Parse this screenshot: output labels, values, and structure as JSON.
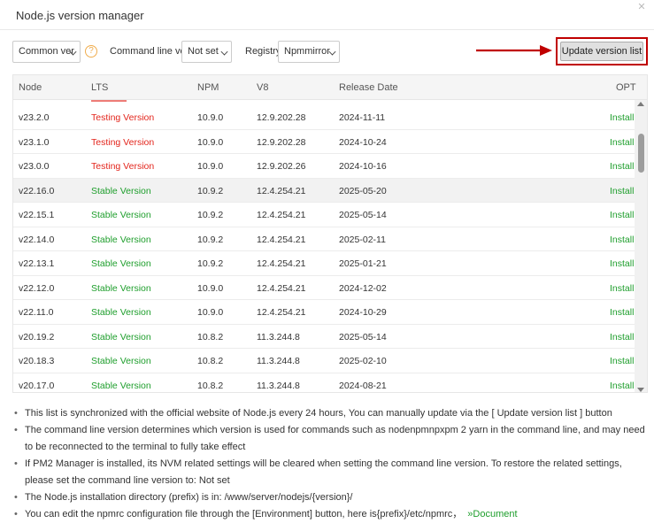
{
  "window": {
    "title": "Node.js version manager"
  },
  "toolbar": {
    "version_filter": "Common ver",
    "help_icon": "?",
    "cmd_label": "Command line ver",
    "cmd_value": "Not set",
    "registry_label": "Registry",
    "registry_value": "Npmmirror",
    "update_label": "Update version list"
  },
  "table": {
    "headers": [
      "Node",
      "LTS",
      "NPM",
      "V8",
      "Release Date",
      "OPT"
    ],
    "rows": [
      {
        "node": "v23.2.0",
        "lts": "Testing Version",
        "npm": "10.9.0",
        "v8": "12.9.202.28",
        "date": "2024-11-11",
        "opt": "Install",
        "kind": "testing"
      },
      {
        "node": "v23.1.0",
        "lts": "Testing Version",
        "npm": "10.9.0",
        "v8": "12.9.202.28",
        "date": "2024-10-24",
        "opt": "Install",
        "kind": "testing"
      },
      {
        "node": "v23.0.0",
        "lts": "Testing Version",
        "npm": "10.9.0",
        "v8": "12.9.202.26",
        "date": "2024-10-16",
        "opt": "Install",
        "kind": "testing"
      },
      {
        "node": "v22.16.0",
        "lts": "Stable Version",
        "npm": "10.9.2",
        "v8": "12.4.254.21",
        "date": "2025-05-20",
        "opt": "Install",
        "kind": "stable"
      },
      {
        "node": "v22.15.1",
        "lts": "Stable Version",
        "npm": "10.9.2",
        "v8": "12.4.254.21",
        "date": "2025-05-14",
        "opt": "Install",
        "kind": "stable"
      },
      {
        "node": "v22.14.0",
        "lts": "Stable Version",
        "npm": "10.9.2",
        "v8": "12.4.254.21",
        "date": "2025-02-11",
        "opt": "Install",
        "kind": "stable"
      },
      {
        "node": "v22.13.1",
        "lts": "Stable Version",
        "npm": "10.9.2",
        "v8": "12.4.254.21",
        "date": "2025-01-21",
        "opt": "Install",
        "kind": "stable"
      },
      {
        "node": "v22.12.0",
        "lts": "Stable Version",
        "npm": "10.9.0",
        "v8": "12.4.254.21",
        "date": "2024-12-02",
        "opt": "Install",
        "kind": "stable"
      },
      {
        "node": "v22.11.0",
        "lts": "Stable Version",
        "npm": "10.9.0",
        "v8": "12.4.254.21",
        "date": "2024-10-29",
        "opt": "Install",
        "kind": "stable"
      },
      {
        "node": "v20.19.2",
        "lts": "Stable Version",
        "npm": "10.8.2",
        "v8": "11.3.244.8",
        "date": "2025-05-14",
        "opt": "Install",
        "kind": "stable"
      },
      {
        "node": "v20.18.3",
        "lts": "Stable Version",
        "npm": "10.8.2",
        "v8": "11.3.244.8",
        "date": "2025-02-10",
        "opt": "Install",
        "kind": "stable"
      },
      {
        "node": "v20.17.0",
        "lts": "Stable Version",
        "npm": "10.8.2",
        "v8": "11.3.244.8",
        "date": "2024-08-21",
        "opt": "Install",
        "kind": "stable"
      }
    ],
    "hover_row_index": 3
  },
  "notes": {
    "items": [
      "This list is synchronized with the official website of Node.js every 24 hours, You can manually update via the [ Update version list ] button",
      "The command line version determines which version is used for commands such as nodenpmnpxpm 2 yarn in the command line, and may need to be reconnected to the terminal to fully take effect",
      "If PM2 Manager is installed, its NVM related settings will be cleared when setting the command line version. To restore the related settings, please set the command line version to: Not set",
      "The Node.js installation directory (prefix) is in: /www/server/nodejs/{version}/",
      "You can edit the npmrc configuration file through the [Environment] button, here is{prefix}/etc/npmrc，"
    ],
    "doc_link": "»Document"
  },
  "colors": {
    "testing": "#e3251c",
    "stable": "#1e9e2c",
    "highlight_border": "#c00000"
  }
}
